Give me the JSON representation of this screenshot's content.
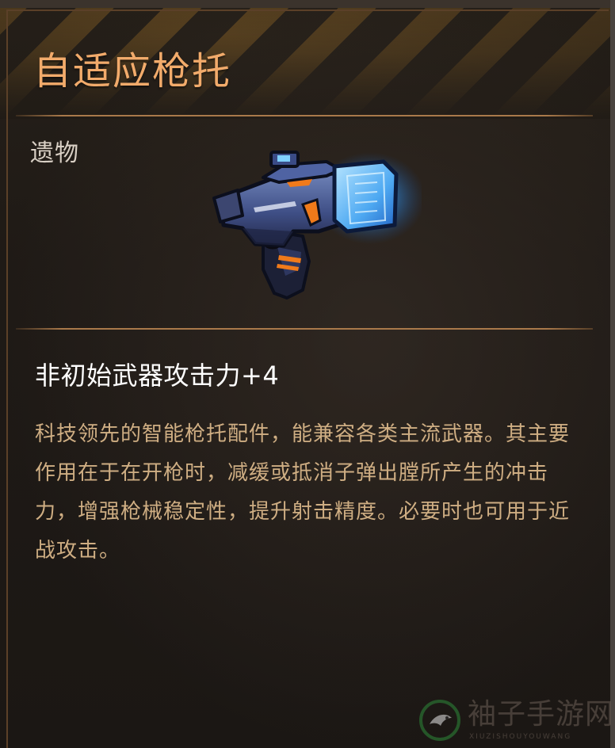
{
  "item": {
    "name": "自适应枪托",
    "category": "遗物",
    "stat": "非初始武器攻击力+4",
    "description": "科技领先的智能枪托配件，能兼容各类主流武器。其主要作用在于在开枪时，减缓或抵消子弹出膛所产生的冲击力，增强枪械稳定性，提升射击精度。必要时也可用于近战攻击。",
    "icon": "energy-pistol-stock-icon"
  },
  "watermark": {
    "text": "袖子手游网",
    "subtext": "XIUZISHOUYOUWANG",
    "icon": "bird-logo-icon"
  },
  "colors": {
    "title": "#f2ab6b",
    "description": "#cfae83",
    "stat": "#ffffff",
    "accent_glow": "#4fb3ff",
    "accent_orange": "#f07a1a"
  }
}
